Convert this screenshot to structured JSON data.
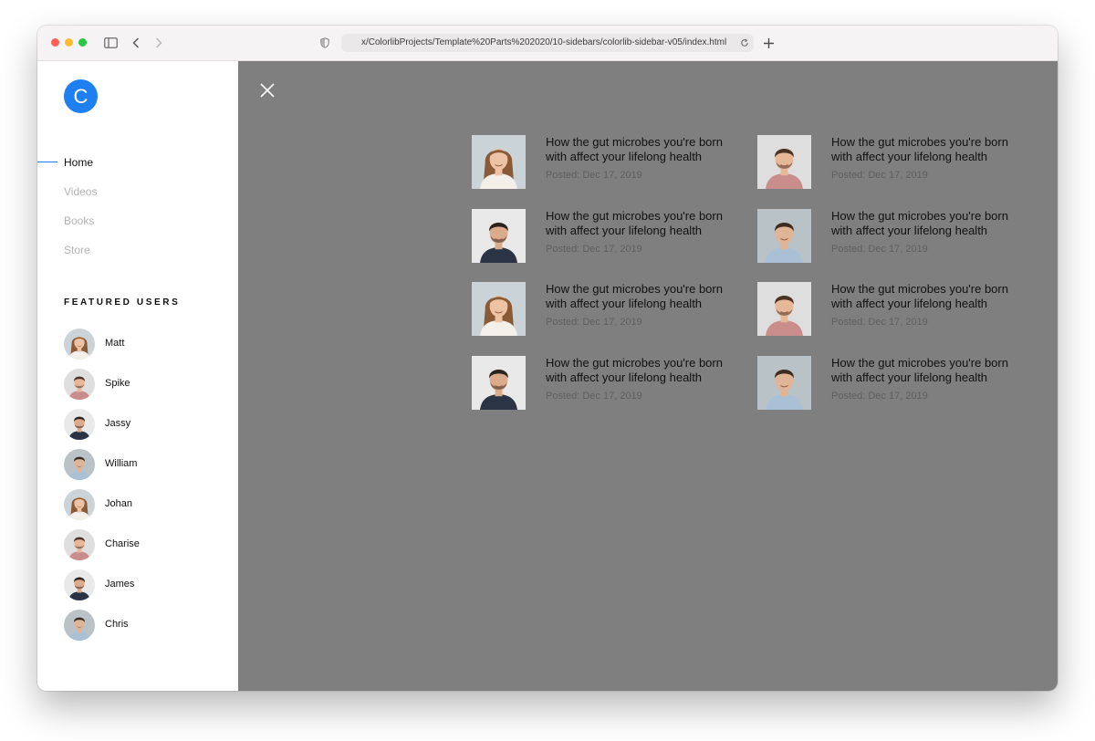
{
  "browser": {
    "url": "x/ColorlibProjects/Template%20Parts%202020/10-sidebars/colorlib-sidebar-v05/index.html"
  },
  "sidebar": {
    "logo_letter": "C",
    "nav": [
      {
        "label": "Home",
        "active": true
      },
      {
        "label": "Videos",
        "active": false
      },
      {
        "label": "Books",
        "active": false
      },
      {
        "label": "Store",
        "active": false
      }
    ],
    "featured_heading": "FEATURED USERS",
    "users": [
      {
        "name": "Matt",
        "avatar": "woman"
      },
      {
        "name": "Spike",
        "avatar": "man-pink-shirt"
      },
      {
        "name": "Jassy",
        "avatar": "man-dark-sweater"
      },
      {
        "name": "William",
        "avatar": "man-blue-shirt"
      },
      {
        "name": "Johan",
        "avatar": "woman"
      },
      {
        "name": "Charise",
        "avatar": "man-pink-shirt"
      },
      {
        "name": "James",
        "avatar": "man-dark-sweater"
      },
      {
        "name": "Chris",
        "avatar": "man-blue-shirt"
      }
    ]
  },
  "posts": [
    {
      "title": "How the gut microbes you're born with affect your lifelong health",
      "date": "Posted: Dec 17, 2019",
      "thumb": "woman"
    },
    {
      "title": "How the gut microbes you're born with affect your lifelong health",
      "date": "Posted: Dec 17, 2019",
      "thumb": "man-pink-shirt"
    },
    {
      "title": "How the gut microbes you're born with affect your lifelong health",
      "date": "Posted: Dec 17, 2019",
      "thumb": "man-dark-sweater"
    },
    {
      "title": "How the gut microbes you're born with affect your lifelong health",
      "date": "Posted: Dec 17, 2019",
      "thumb": "man-blue-shirt"
    },
    {
      "title": "How the gut microbes you're born with affect your lifelong health",
      "date": "Posted: Dec 17, 2019",
      "thumb": "woman"
    },
    {
      "title": "How the gut microbes you're born with affect your lifelong health",
      "date": "Posted: Dec 17, 2019",
      "thumb": "man-pink-shirt"
    },
    {
      "title": "How the gut microbes you're born with affect your lifelong health",
      "date": "Posted: Dec 17, 2019",
      "thumb": "man-dark-sweater"
    },
    {
      "title": "How the gut microbes you're born with affect your lifelong health",
      "date": "Posted: Dec 17, 2019",
      "thumb": "man-blue-shirt"
    }
  ],
  "icons": {
    "sidebar_toggle": "sidebar-toggle-icon",
    "back": "chevron-left-icon",
    "forward": "chevron-right-icon",
    "shield": "shield-icon",
    "reload": "reload-icon",
    "new_tab": "plus-icon",
    "close": "close-icon"
  },
  "colors": {
    "accent": "#1e7ff0",
    "overlay": "#7f7f7f",
    "nav_inactive": "#b3b3b3",
    "text": "#111111"
  }
}
